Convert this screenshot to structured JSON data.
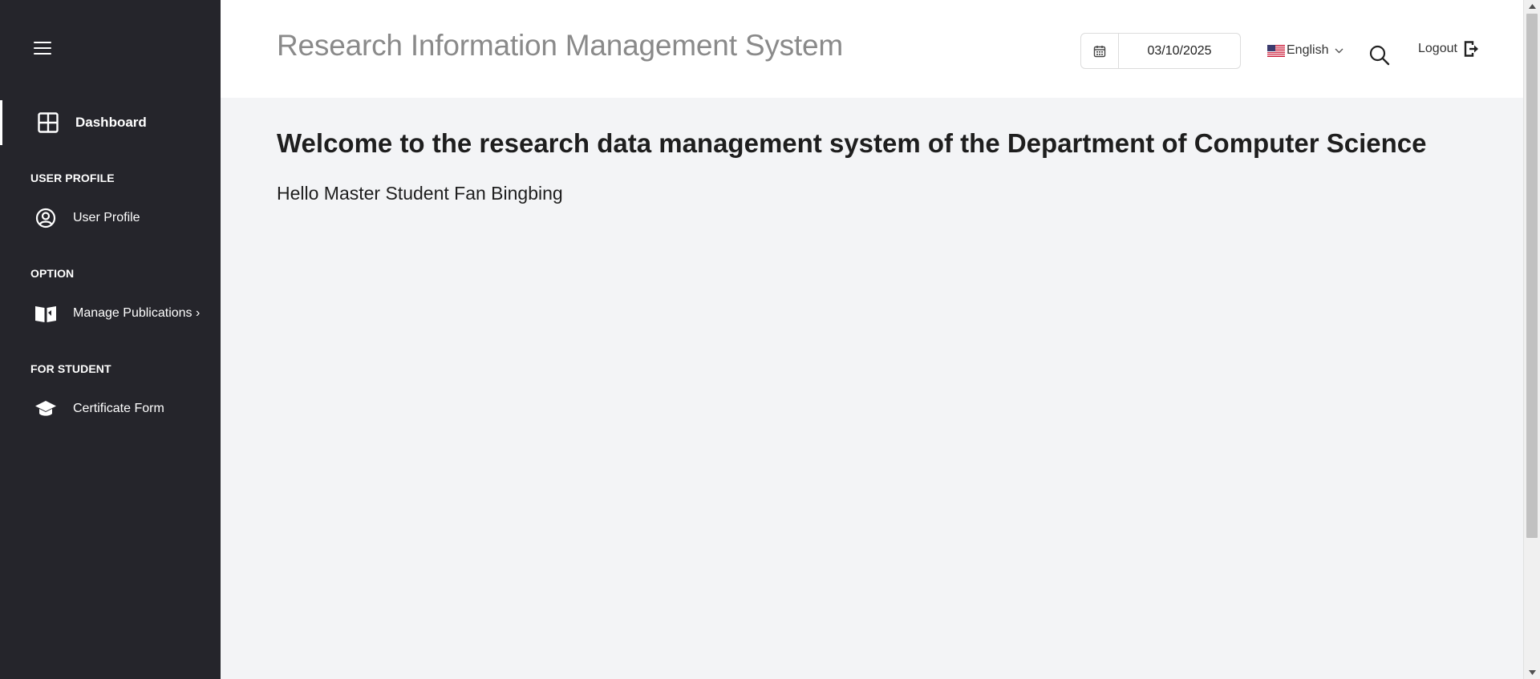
{
  "sidebar": {
    "menu_icon": "hamburger-icon",
    "dashboard": {
      "label": "Dashboard",
      "icon": "grid-icon"
    },
    "sections": [
      {
        "title": "USER PROFILE",
        "items": [
          {
            "label": "User Profile",
            "icon": "user-circle-icon"
          }
        ]
      },
      {
        "title": "OPTION",
        "items": [
          {
            "label": "Manage Publications",
            "icon": "book-open-icon",
            "chevron": "›"
          }
        ]
      },
      {
        "title": "FOR STUDENT",
        "items": [
          {
            "label": "Certificate Form",
            "icon": "graduation-cap-icon"
          }
        ]
      }
    ]
  },
  "header": {
    "title": "Research Information Management System",
    "date": {
      "value": "03/10/2025",
      "icon": "calendar-icon"
    },
    "language": {
      "selected": "English",
      "flag_icon": "us-flag-icon"
    },
    "search_icon": "search-icon",
    "logout": {
      "label": "Logout",
      "icon": "logout-icon"
    }
  },
  "main": {
    "welcome": "Welcome to the research data management system of the Department of Computer Science",
    "greeting": "Hello Master Student Fan Bingbing"
  },
  "colors": {
    "sidebar_bg": "#25252b",
    "content_bg": "#f3f4f6",
    "title_gray": "#8a8a8a"
  }
}
